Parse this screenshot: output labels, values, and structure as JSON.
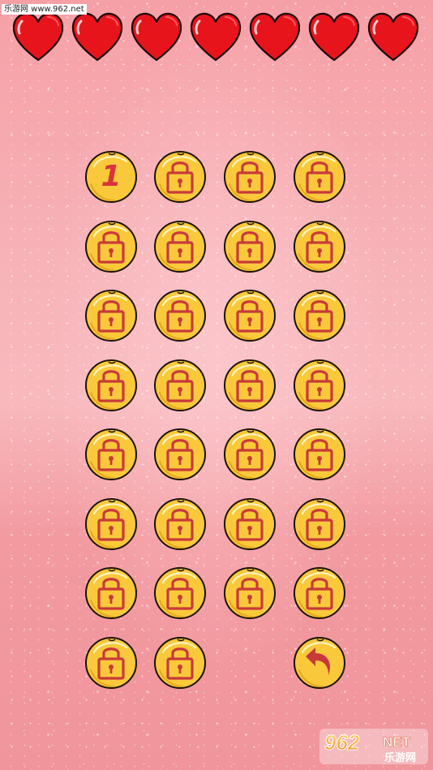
{
  "watermark": "乐游网 www.962.net",
  "lives": {
    "count": 7,
    "icon": "heart-icon",
    "color": "#e8141c"
  },
  "levels": {
    "items": [
      {
        "number": "1",
        "locked": false
      },
      {
        "locked": true
      },
      {
        "locked": true
      },
      {
        "locked": true
      },
      {
        "locked": true
      },
      {
        "locked": true
      },
      {
        "locked": true
      },
      {
        "locked": true
      },
      {
        "locked": true
      },
      {
        "locked": true
      },
      {
        "locked": true
      },
      {
        "locked": true
      },
      {
        "locked": true
      },
      {
        "locked": true
      },
      {
        "locked": true
      },
      {
        "locked": true
      },
      {
        "locked": true
      },
      {
        "locked": true
      },
      {
        "locked": true
      },
      {
        "locked": true
      },
      {
        "locked": true
      },
      {
        "locked": true
      },
      {
        "locked": true
      },
      {
        "locked": true
      },
      {
        "locked": true
      },
      {
        "locked": true
      },
      {
        "locked": true
      },
      {
        "locked": true
      },
      {
        "locked": true
      },
      {
        "locked": true
      }
    ],
    "button_color": "#f9c93b",
    "lock_color": "#c83a3a"
  },
  "back_button": {
    "icon": "back-arrow-icon"
  },
  "logo": {
    "text_top": "962",
    "text_top_suffix": "NET",
    "text_bottom": "乐游网"
  }
}
